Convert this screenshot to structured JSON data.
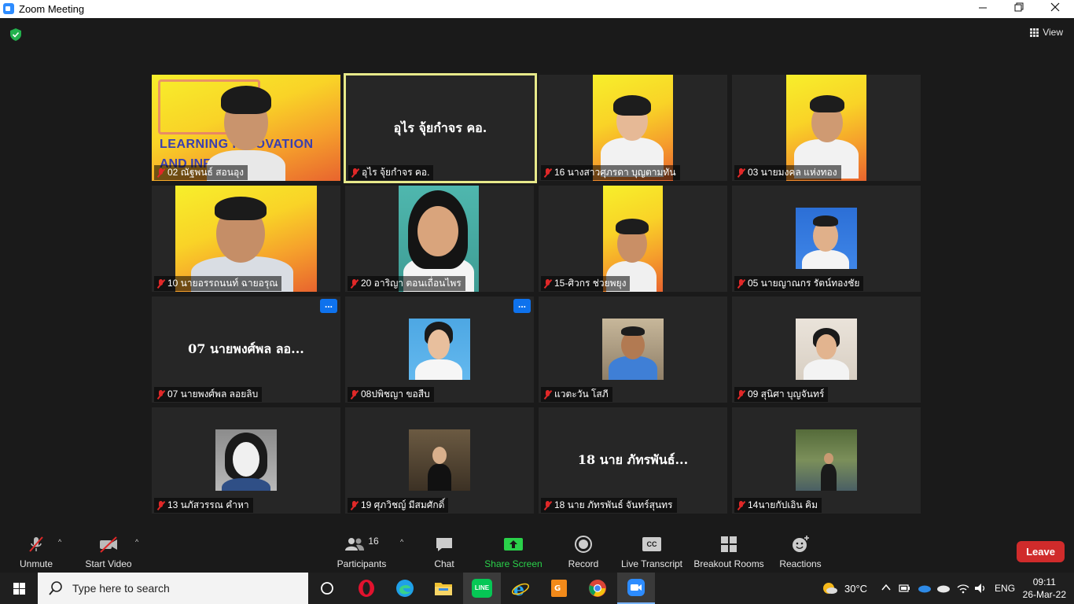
{
  "window": {
    "title": "Zoom Meeting",
    "minimize_icon": "minimize-icon",
    "maximize_icon": "restore-icon",
    "close_icon": "close-icon"
  },
  "meeting": {
    "view_label": "View",
    "tiles": [
      {
        "name": "02 ณัฐพนธ์ สอนอุง",
        "muted": true
      },
      {
        "name": "อุไร จุ้ยกำจร คอ.",
        "display": "อุไร จุ้ยกำจร คอ.",
        "muted": true,
        "active": true
      },
      {
        "name": "16 นางสาวศุภรดา บุญตามทัน",
        "muted": true
      },
      {
        "name": "03 นายมงคล แห่งทอง",
        "muted": true
      },
      {
        "name": "10 นายอรรถนนท์ ฉายอรุณ",
        "muted": true
      },
      {
        "name": "20 อาริญา ตอนเถื่อนไพร",
        "muted": true
      },
      {
        "name": "15-ศิวกร ช่วยพยุง",
        "muted": true
      },
      {
        "name": "05 นายญาณกร รัตน์ทองชัย",
        "muted": true
      },
      {
        "name": "07 นายพงศ์พล ลอยลิบ",
        "display": "07 นายพงศ์พล ลอ...",
        "muted": true,
        "more": "..."
      },
      {
        "name": "08ปพิชญา ขอสืบ",
        "muted": true,
        "more": "..."
      },
      {
        "name": "แวตะวัน โสภี",
        "muted": true
      },
      {
        "name": "09 สุนิศา บุญจันทร์",
        "muted": true
      },
      {
        "name": "13 นภัสวรรณ คำหา",
        "muted": true
      },
      {
        "name": "19 ศุภวิชญ์ มีสมศักดิ์",
        "muted": true
      },
      {
        "name": "18 นาย ภัทรพันธ์ จันทร์สุนทร",
        "display": "18 นาย ภัทรพันธ์...",
        "muted": true
      },
      {
        "name": "14นายกัปเอิน คิม",
        "muted": true
      }
    ],
    "lit_text_1": "LEARNING INNOVATION",
    "lit_text_2": "AND INFORMATION"
  },
  "toolbar": {
    "unmute": "Unmute",
    "start_video": "Start Video",
    "participants": "Participants",
    "participants_count": "16",
    "chat": "Chat",
    "share_screen": "Share Screen",
    "record": "Record",
    "live_transcript": "Live Transcript",
    "cc": "CC",
    "breakout_rooms": "Breakout Rooms",
    "reactions": "Reactions",
    "leave": "Leave",
    "caret": "^"
  },
  "taskbar": {
    "search_placeholder": "Type here to search",
    "line_label": "LINE",
    "weather": "30°C",
    "language": "ENG",
    "time": "09:11",
    "date": "26-Mar-22"
  },
  "colors": {
    "zoom_blue": "#2D8CFF",
    "share_green": "#2ad14a",
    "leave_red": "#d02b2b",
    "active_border": "#e7e98a",
    "mute_red": "#e02828"
  }
}
